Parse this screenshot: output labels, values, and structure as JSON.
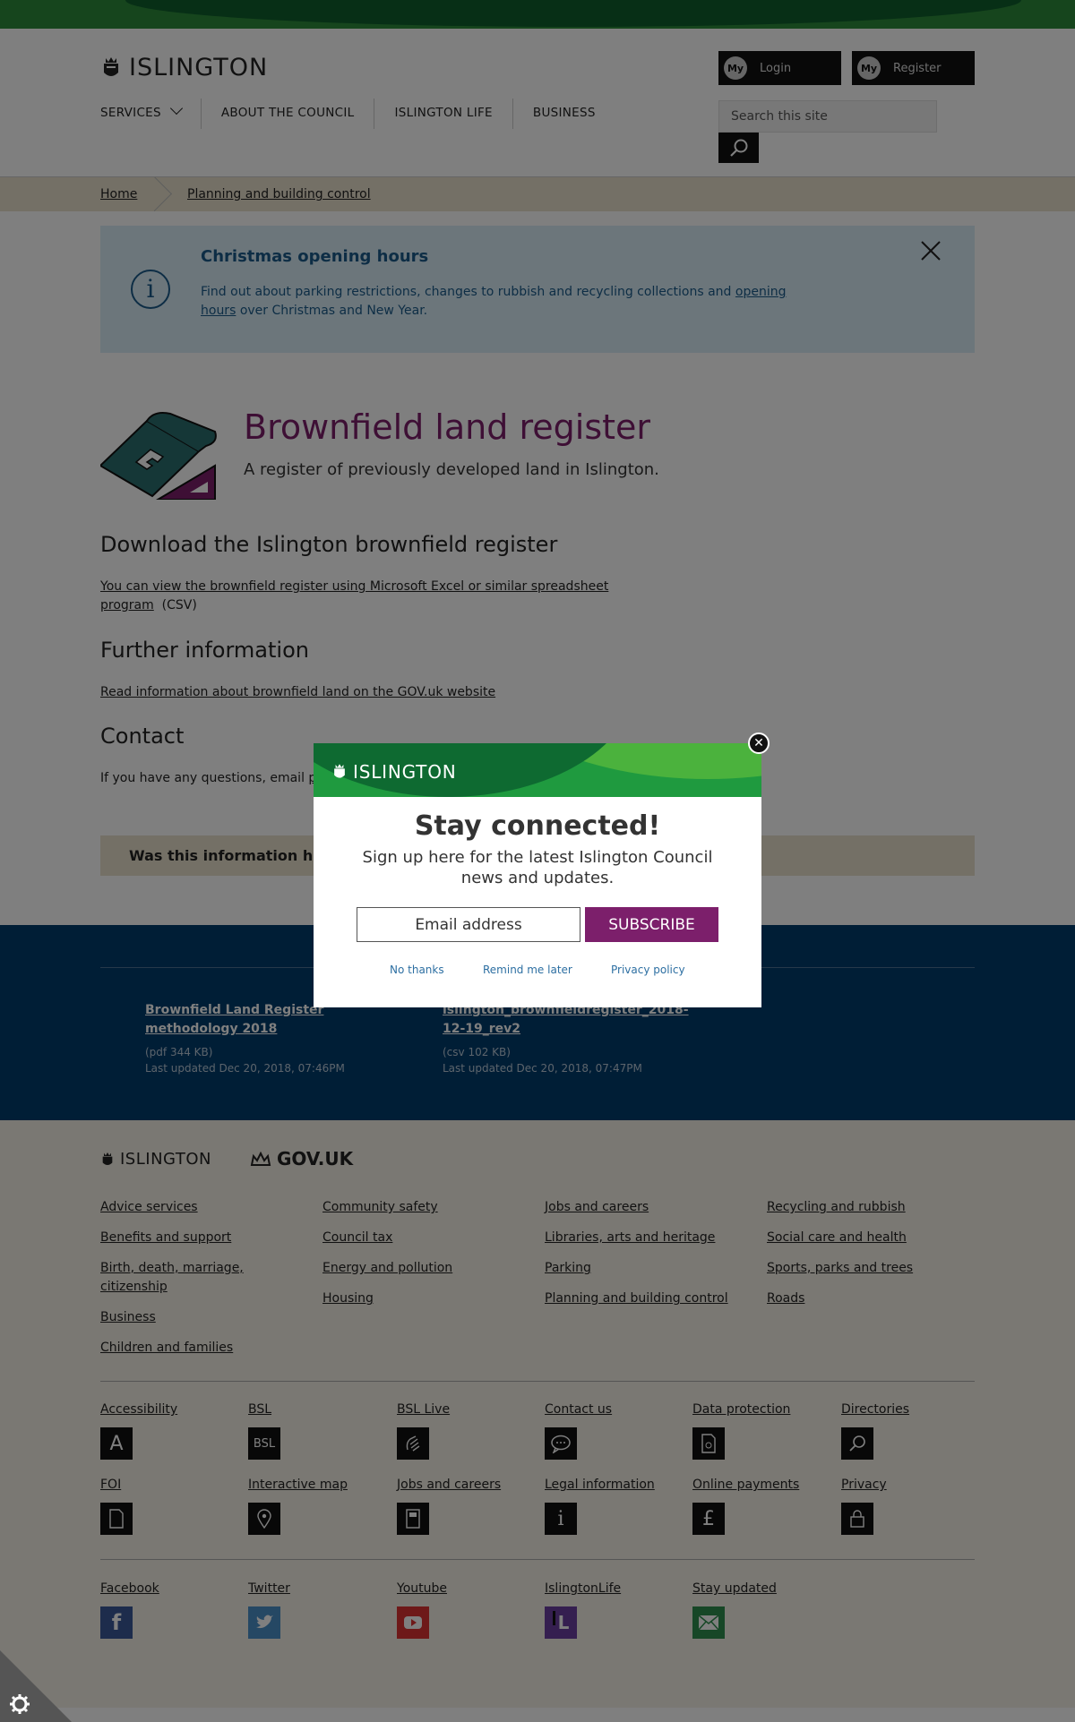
{
  "header": {
    "logo_text": "ISLINGTON",
    "login_label": "Login",
    "register_label": "Register",
    "my_badge": "My",
    "search_placeholder": "Search this site",
    "nav": [
      "SERVICES",
      "ABOUT THE COUNCIL",
      "ISLINGTON LIFE",
      "BUSINESS"
    ]
  },
  "breadcrumb": [
    "Home",
    "Planning and building control"
  ],
  "alert": {
    "title": "Christmas opening hours",
    "body_before": "Find out about parking restrictions, changes to rubbish and recycling collections and ",
    "body_link": "opening hours",
    "body_after": " over Christmas and New Year."
  },
  "page": {
    "title": "Brownfield land register",
    "subtitle": "A register of previously developed land in Islington.",
    "section1_heading": "Download the Islington brownfield register",
    "section1_link": "You can view the brownfield register using Microsoft Excel or similar spreadsheet program",
    "section1_suffix": "(CSV)",
    "section2_heading": "Further information",
    "section2_link": "Read information about brownfield land on the GOV.uk website",
    "section3_heading": "Contact",
    "section3_text": "If you have any questions, email ",
    "section3_link_partial": "p",
    "feedback": "Was this information h"
  },
  "downloads": [
    {
      "title": "Brownfield Land Register methodology 2018",
      "meta": "(pdf 344 KB)",
      "updated": "Last updated Dec 20, 2018, 07:46PM"
    },
    {
      "title": "islington_brownfieldregister_2018-12-19_rev2",
      "meta": "(csv 102 KB)",
      "updated": "Last updated Dec 20, 2018, 07:47PM"
    }
  ],
  "footer": {
    "logo_text": "ISLINGTON",
    "govuk": "GOV.UK",
    "col1": [
      "Advice services",
      "Benefits and support",
      "Birth, death, marriage, citizenship",
      "Business",
      "Children and families"
    ],
    "col2": [
      "Community safety",
      "Council tax",
      "Energy and pollution",
      "Housing"
    ],
    "col3": [
      "Jobs and careers",
      "Libraries, arts and heritage",
      "Parking",
      "Planning and building control"
    ],
    "col4": [
      "Recycling and rubbish",
      "Social care and health",
      "Sports, parks and trees",
      "Roads"
    ],
    "utility_row1": [
      "Accessibility",
      "BSL",
      "BSL Live",
      "Contact us",
      "Data protection",
      "Directories"
    ],
    "utility_row2": [
      "FOI",
      "Interactive map",
      "Jobs and careers",
      "Legal information",
      "Online payments",
      "Privacy"
    ],
    "social": [
      "Facebook",
      "Twitter",
      "Youtube",
      "IslingtonLife",
      "Stay updated"
    ],
    "bsl_icon_text": "BSL",
    "colors": {
      "facebook": "#3b5998",
      "twitter": "#4a90c8",
      "youtube": "#d33",
      "islingtonlife": "#6a3fa0",
      "stayupdated": "#2f8f4e"
    }
  },
  "modal": {
    "logo_text": "ISLINGTON",
    "title": "Stay connected!",
    "text": "Sign up here for the latest Islington Council news and updates.",
    "email_placeholder": "Email address",
    "subscribe_label": "SUBSCRIBE",
    "no_thanks": "No thanks",
    "remind_later": "Remind me later",
    "privacy": "Privacy policy"
  },
  "colors": {
    "brand_purple": "#7c1f6b",
    "brand_green": "#1f9a3f",
    "navy": "#003c6c"
  }
}
